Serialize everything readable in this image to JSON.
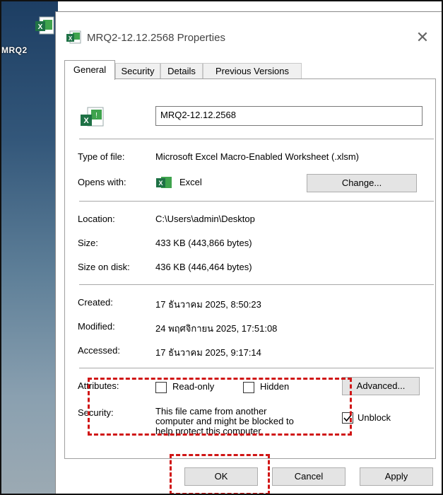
{
  "desktop": {
    "icon_label": "MRQ2"
  },
  "window": {
    "title": "MRQ2-12.12.2568 Properties",
    "close_glyph": "✕"
  },
  "tabs": [
    {
      "label": "General",
      "active": true
    },
    {
      "label": "Security",
      "active": false
    },
    {
      "label": "Details",
      "active": false
    },
    {
      "label": "Previous Versions",
      "active": false
    }
  ],
  "general": {
    "filename": "MRQ2-12.12.2568",
    "type_label": "Type of file:",
    "type_value": "Microsoft Excel Macro-Enabled Worksheet (.xlsm)",
    "opens_label": "Opens with:",
    "opens_value": "Excel",
    "change_button": "Change...",
    "location_label": "Location:",
    "location_value": "C:\\Users\\admin\\Desktop",
    "size_label": "Size:",
    "size_value": "433 KB (443,866 bytes)",
    "size_on_disk_label": "Size on disk:",
    "size_on_disk_value": "436 KB (446,464 bytes)",
    "created_label": "Created:",
    "created_value": "17 ธันวาคม 2025, 8:50:23",
    "modified_label": "Modified:",
    "modified_value": "24 พฤศจิกายน 2025, 17:51:08",
    "accessed_label": "Accessed:",
    "accessed_value": "17 ธันวาคม 2025, 9:17:14",
    "attributes_label": "Attributes:",
    "readonly_label": "Read-only",
    "readonly_checked": false,
    "hidden_label": "Hidden",
    "hidden_checked": false,
    "advanced_button": "Advanced...",
    "security_label": "Security:",
    "security_line1": "This file came from another",
    "security_line2": "computer and might be blocked to",
    "security_line3": "help protect this computer.",
    "unblock_label": "Unblock",
    "unblock_checked": true
  },
  "footer": {
    "ok": "OK",
    "cancel": "Cancel",
    "apply": "Apply"
  },
  "colors": {
    "highlight_dash": "#d01616",
    "excel_green": "#1e7145"
  },
  "icons": [
    "excel-file-icon",
    "close-icon",
    "checkbox-checked-icon"
  ]
}
